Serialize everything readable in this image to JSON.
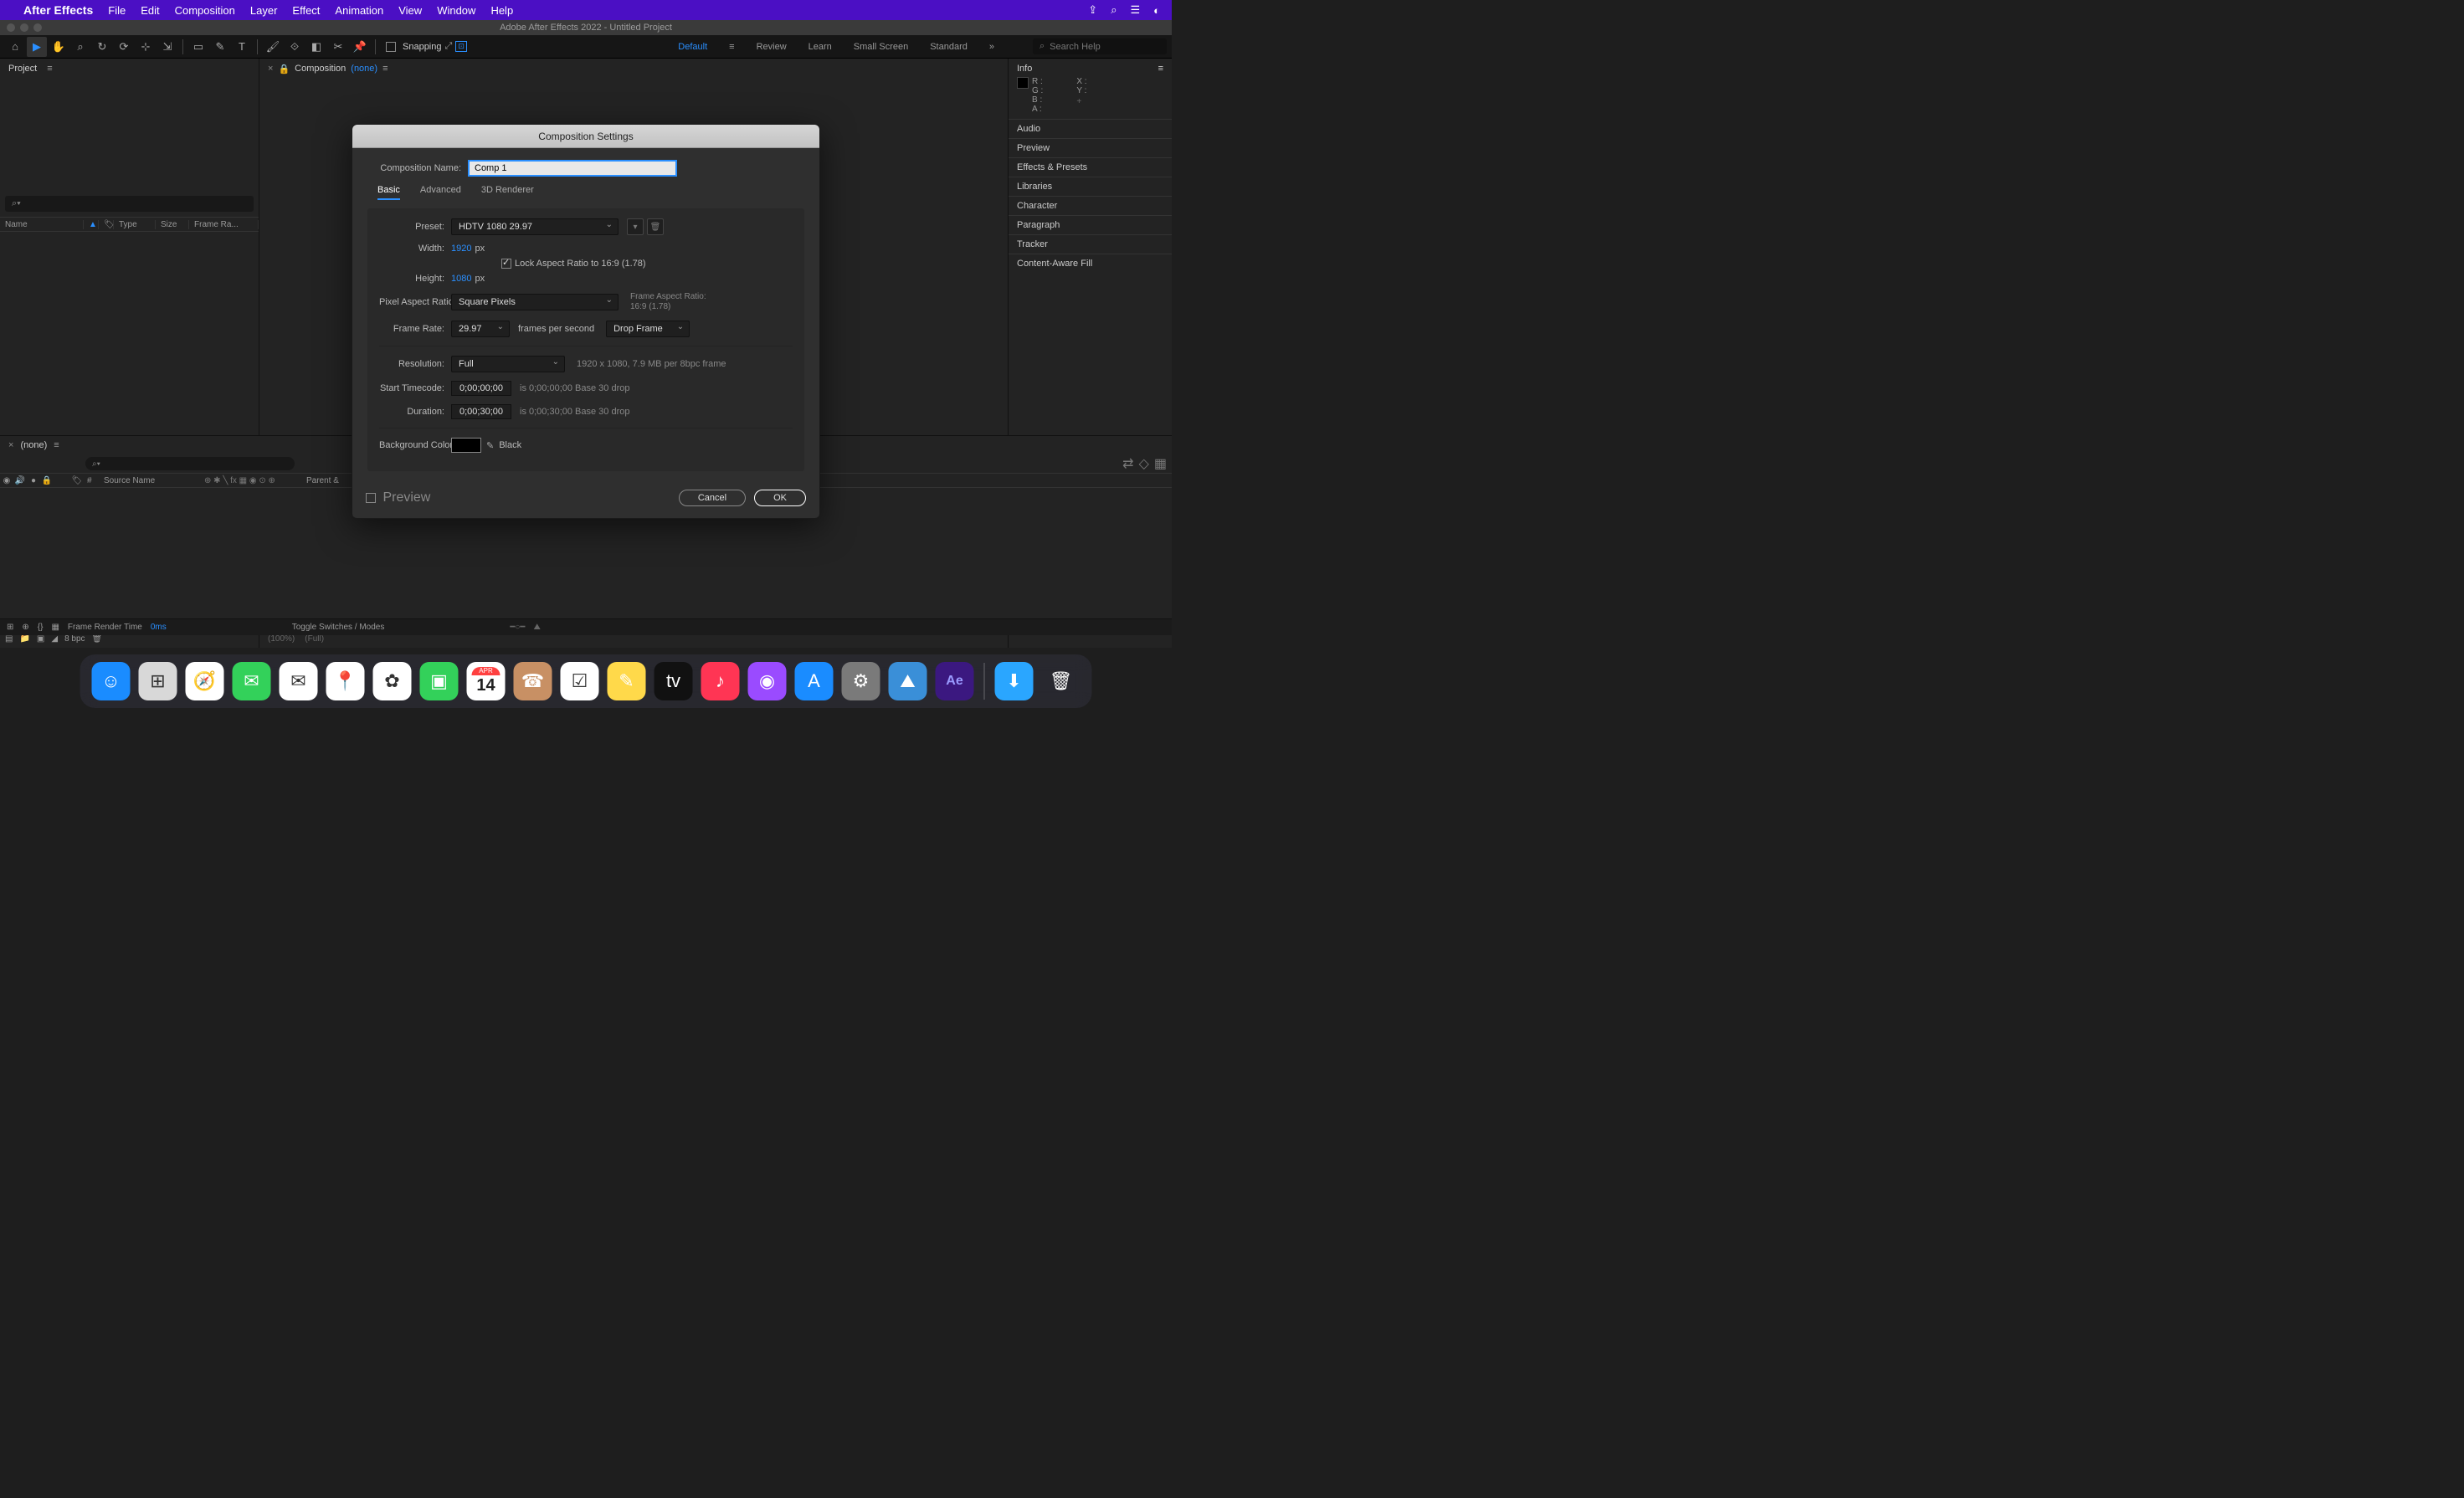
{
  "menubar": {
    "appname": "After Effects",
    "items": [
      "File",
      "Edit",
      "Composition",
      "Layer",
      "Effect",
      "Animation",
      "View",
      "Window",
      "Help"
    ]
  },
  "window_title": "Adobe After Effects 2022 - Untitled Project",
  "toolbar": {
    "snapping_label": "Snapping",
    "workspaces": [
      "Default",
      "Review",
      "Learn",
      "Small Screen",
      "Standard"
    ],
    "search_placeholder": "Search Help"
  },
  "project_panel": {
    "title": "Project",
    "search_placeholder": "",
    "cols": [
      "Name",
      "",
      "Type",
      "Size",
      "Frame Ra..."
    ],
    "bpc": "8 bpc"
  },
  "comp_panel": {
    "label": "Composition",
    "current": "(none)",
    "zoom": "(100%)",
    "res": "(Full)"
  },
  "right_panels": {
    "info": "Info",
    "r": "R :",
    "g": "G :",
    "b": "B :",
    "a": "A :",
    "x": "X :",
    "y": "Y :",
    "sections": [
      "Audio",
      "Preview",
      "Effects & Presets",
      "Libraries",
      "Character",
      "Paragraph",
      "Tracker",
      "Content-Aware Fill"
    ]
  },
  "timeline": {
    "tab": "(none)",
    "col_num": "#",
    "col_source": "Source Name",
    "col_parent": "Parent &",
    "toggle_label": "Toggle Switches / Modes",
    "render_label": "Frame Render Time",
    "render_time": "0ms"
  },
  "dialog": {
    "title": "Composition Settings",
    "name_label": "Composition Name:",
    "name_value": "Comp 1",
    "tabs": [
      "Basic",
      "Advanced",
      "3D Renderer"
    ],
    "preset_label": "Preset:",
    "preset_value": "HDTV 1080 29.97",
    "width_label": "Width:",
    "width_value": "1920",
    "px": "px",
    "height_label": "Height:",
    "height_value": "1080",
    "lock_label": "Lock Aspect Ratio to 16:9 (1.78)",
    "par_label": "Pixel Aspect Ratio:",
    "par_value": "Square Pixels",
    "far_label": "Frame Aspect Ratio:",
    "far_value": "16:9 (1.78)",
    "fr_label": "Frame Rate:",
    "fr_value": "29.97",
    "fps_label": "frames per second",
    "drop_value": "Drop Frame",
    "res_label": "Resolution:",
    "res_value": "Full",
    "res_info": "1920 x 1080, 7.9 MB per 8bpc frame",
    "start_label": "Start Timecode:",
    "start_value": "0;00;00;00",
    "start_info": "is 0;00;00;00  Base 30  drop",
    "dur_label": "Duration:",
    "dur_value": "0;00;30;00",
    "dur_info": "is 0;00;30;00  Base 30  drop",
    "bg_label": "Background Color:",
    "bg_name": "Black",
    "preview_label": "Preview",
    "cancel": "Cancel",
    "ok": "OK"
  },
  "dock": {
    "apps": [
      {
        "name": "finder",
        "bg": "#1a8cff",
        "glyph": "☺"
      },
      {
        "name": "launchpad",
        "bg": "#d8d8d8",
        "glyph": "⊞"
      },
      {
        "name": "safari",
        "bg": "#ffffff",
        "glyph": "🧭"
      },
      {
        "name": "messages",
        "bg": "#33d15a",
        "glyph": "✉"
      },
      {
        "name": "mail",
        "bg": "#ffffff",
        "glyph": "✉"
      },
      {
        "name": "maps",
        "bg": "#ffffff",
        "glyph": "📍"
      },
      {
        "name": "photos",
        "bg": "#ffffff",
        "glyph": "✿"
      },
      {
        "name": "facetime",
        "bg": "#33d15a",
        "glyph": "▣"
      },
      {
        "name": "calendar",
        "bg": "#ffffff",
        "glyph": "14"
      },
      {
        "name": "contacts",
        "bg": "#c89064",
        "glyph": "☎"
      },
      {
        "name": "reminders",
        "bg": "#ffffff",
        "glyph": "☑"
      },
      {
        "name": "notes",
        "bg": "#ffd94a",
        "glyph": "✎"
      },
      {
        "name": "appletv",
        "bg": "#111",
        "glyph": "tv"
      },
      {
        "name": "music",
        "bg": "#ff3554",
        "glyph": "♪"
      },
      {
        "name": "podcasts",
        "bg": "#9a4bff",
        "glyph": "◉"
      },
      {
        "name": "appstore",
        "bg": "#1a8cff",
        "glyph": "A"
      },
      {
        "name": "sysprefs",
        "bg": "#7a7a7a",
        "glyph": "⚙"
      },
      {
        "name": "screenshot",
        "bg": "#3a8fd8",
        "glyph": "⛰"
      },
      {
        "name": "aftereffects",
        "bg": "#3b1880",
        "glyph": "Ae"
      }
    ],
    "right": [
      {
        "name": "downloads",
        "bg": "#2aa6ff",
        "glyph": "⬇"
      },
      {
        "name": "trash",
        "bg": "transparent",
        "glyph": "🗑"
      }
    ],
    "cal_month": "APR",
    "cal_day": "14"
  }
}
